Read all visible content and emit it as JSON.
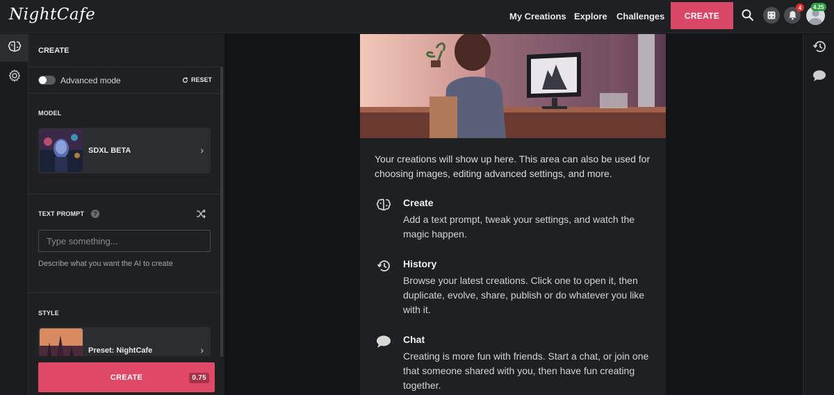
{
  "app": {
    "logo_text": "NightCafe"
  },
  "nav": {
    "links": [
      "My Creations",
      "Explore",
      "Challenges"
    ],
    "create_label": "CREATE",
    "notification_count": "4",
    "balance": "4.25",
    "icons": [
      "search-icon",
      "dice-icon",
      "bell-icon",
      "avatar"
    ]
  },
  "rail": {
    "icons": [
      "brain-icon",
      "gear-icon"
    ]
  },
  "panel": {
    "header": "CREATE",
    "advanced_mode_label": "Advanced mode",
    "advanced_mode_on": false,
    "reset_label": "RESET",
    "model": {
      "section_label": "MODEL",
      "name": "SDXL BETA"
    },
    "prompt": {
      "section_label": "TEXT PROMPT",
      "help_glyph": "?",
      "placeholder": "Type something...",
      "value": "",
      "helper": "Describe what you want the AI to create"
    },
    "style": {
      "section_label": "STYLE",
      "name": "Preset: NightCafe"
    },
    "create_label": "CREATE",
    "cost": "0.75"
  },
  "main": {
    "intro": "Your creations will show up here. This area can also be used for choosing images, editing advanced settings, and more.",
    "features": [
      {
        "icon": "brain-icon",
        "title": "Create",
        "desc": "Add a text prompt, tweak your settings, and watch the magic happen."
      },
      {
        "icon": "history-icon",
        "title": "History",
        "desc": "Browse your latest creations. Click one to open it, then duplicate, evolve, share, publish or do whatever you like with it."
      },
      {
        "icon": "chat-icon",
        "title": "Chat",
        "desc": "Creating is more fun with friends. Start a chat, or join one that someone shared with you, then have fun creating together."
      }
    ]
  },
  "right_rail": {
    "icons": [
      "history-icon",
      "chat-icon"
    ]
  },
  "colors": {
    "accent": "#e04868",
    "background": "#121416",
    "panel": "#1e2022",
    "success": "#2e9e3e",
    "alert": "#d92e2e"
  }
}
